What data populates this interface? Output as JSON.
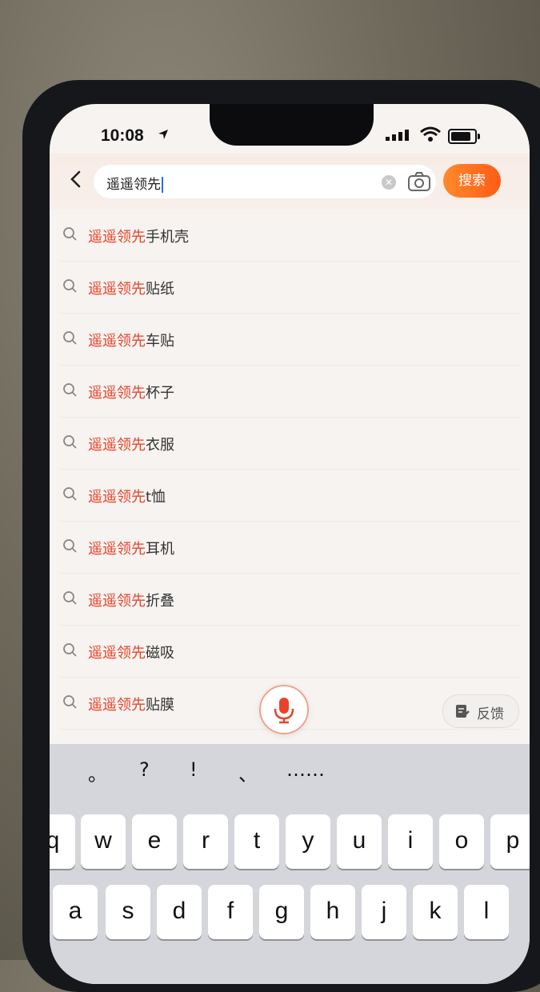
{
  "status_bar": {
    "time": "10:08"
  },
  "search": {
    "query": "遥遥领先",
    "search_button_label": "搜索"
  },
  "suggestions": [
    {
      "highlight": "遥遥领先",
      "rest": "手机壳"
    },
    {
      "highlight": "遥遥领先",
      "rest": "贴纸"
    },
    {
      "highlight": "遥遥领先",
      "rest": "车贴"
    },
    {
      "highlight": "遥遥领先",
      "rest": "杯子"
    },
    {
      "highlight": "遥遥领先",
      "rest": "衣服"
    },
    {
      "highlight": "遥遥领先",
      "rest": "t恤"
    },
    {
      "highlight": "遥遥领先",
      "rest": "耳机"
    },
    {
      "highlight": "遥遥领先",
      "rest": "折叠"
    },
    {
      "highlight": "遥遥领先",
      "rest": "磁吸"
    },
    {
      "highlight": "遥遥领先",
      "rest": "贴膜"
    }
  ],
  "feedback_label": "反馈",
  "keyboard": {
    "punctuation": [
      ",",
      "。",
      "?",
      "!",
      "、",
      "……"
    ],
    "row1": [
      "q",
      "w",
      "e",
      "r",
      "t",
      "y",
      "u",
      "i",
      "o",
      "p"
    ],
    "row2": [
      "a",
      "s",
      "d",
      "f",
      "g",
      "h",
      "j",
      "k",
      "l"
    ]
  },
  "colors": {
    "accent": "#ff6a1f",
    "highlight": "#e8432a"
  },
  "icons": {
    "back": "chevron-left-icon",
    "clear": "clear-icon",
    "camera": "camera-icon",
    "search": "search-icon",
    "mic": "microphone-icon",
    "feedback": "feedback-icon"
  }
}
